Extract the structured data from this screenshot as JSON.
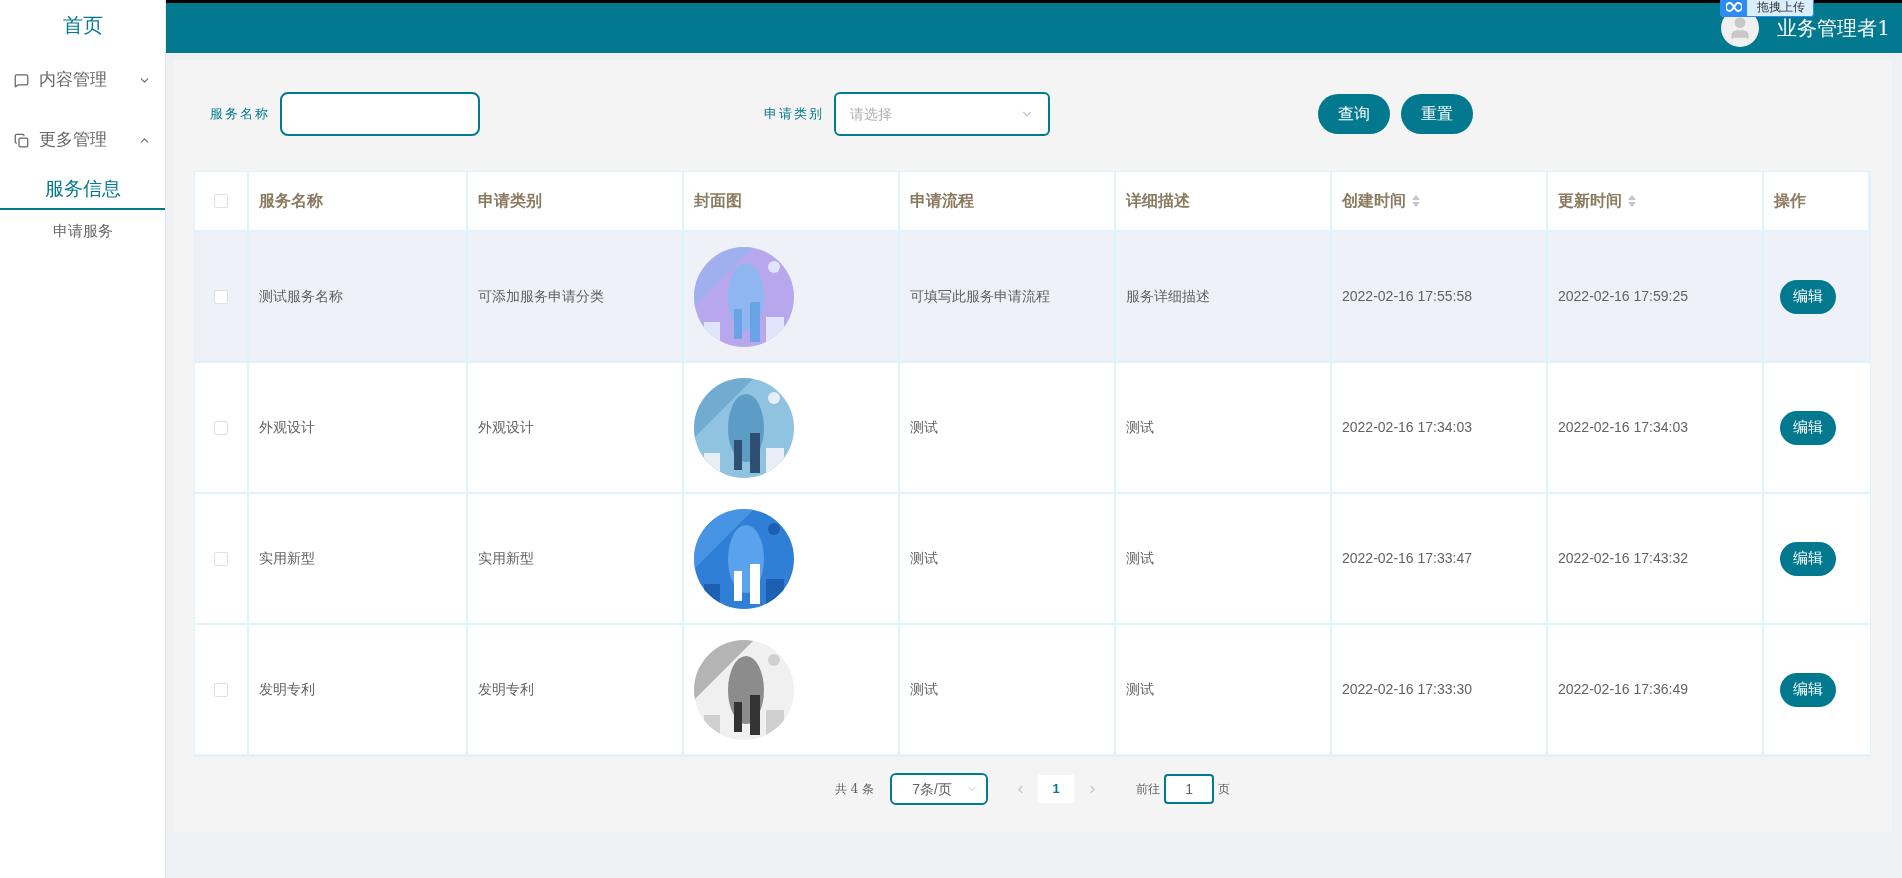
{
  "sidebar": {
    "home": "首页",
    "groups": [
      {
        "label": "内容管理",
        "expanded": false
      },
      {
        "label": "更多管理",
        "expanded": true,
        "children": [
          {
            "label": "服务信息",
            "selected": true
          },
          {
            "label": "申请服务",
            "selected": false
          }
        ]
      }
    ]
  },
  "header": {
    "user": "业务管理者1",
    "upload_widget": "拖拽上传"
  },
  "filters": [
    {
      "kind": "input",
      "label": "服务名称"
    },
    {
      "kind": "select",
      "label": "申请类别",
      "placeholder": "请选择"
    }
  ],
  "buttons": [
    "查询",
    "重置"
  ],
  "table": {
    "header_checked": false,
    "columns": [
      {
        "label": "服务名称",
        "sortable": false
      },
      {
        "label": "申请类别",
        "sortable": false
      },
      {
        "label": "封面图",
        "sortable": false
      },
      {
        "label": "申请流程",
        "sortable": false
      },
      {
        "label": "详细描述",
        "sortable": false
      },
      {
        "label": "创建时间",
        "sortable": true
      },
      {
        "label": "更新时间",
        "sortable": true
      },
      {
        "label": "操作",
        "sortable": false
      }
    ],
    "rows": [
      {
        "hovered": true,
        "checked": false,
        "cells": [
          "测试服务名称",
          "可添加服务申请分类",
          {
            "kind": "picture"
          },
          "可填写此服务申请流程",
          "服务详细描述",
          "2022-02-16 17:55:58",
          "2022-02-16 17:59:25"
        ],
        "action": "编辑"
      },
      {
        "hovered": false,
        "checked": false,
        "cells": [
          "外观设计",
          "外观设计",
          {
            "kind": "picture"
          },
          "测试",
          "测试",
          "2022-02-16 17:34:03",
          "2022-02-16 17:34:03"
        ],
        "action": "编辑"
      },
      {
        "hovered": false,
        "checked": false,
        "cells": [
          "实用新型",
          "实用新型",
          {
            "kind": "picture"
          },
          "测试",
          "测试",
          "2022-02-16 17:33:47",
          "2022-02-16 17:43:32"
        ],
        "action": "编辑"
      },
      {
        "hovered": false,
        "checked": false,
        "cells": [
          "发明专利",
          "发明专利",
          {
            "kind": "picture"
          },
          "测试",
          "测试",
          "2022-02-16 17:33:30",
          "2022-02-16 17:36:49"
        ],
        "action": "编辑"
      }
    ]
  },
  "pagination": {
    "total": "共 4 条",
    "page_size": "7条/页",
    "pages": [
      {
        "label": "1",
        "selected": true
      }
    ],
    "goto_label": "前往",
    "goto_value": "1",
    "goto_suffix": "页"
  }
}
